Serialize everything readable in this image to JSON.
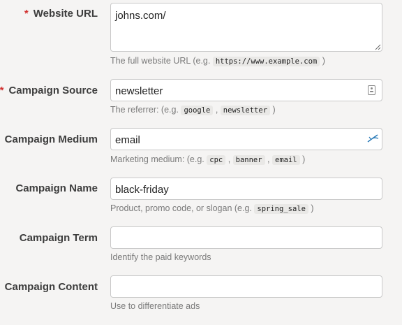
{
  "form": {
    "website_url": {
      "label": "Website URL",
      "required_mark": "*",
      "value": "johns.com/",
      "help_prefix": "The full website URL (e.g. ",
      "help_code": "https://www.example.com",
      "help_suffix": " )"
    },
    "campaign_source": {
      "label": "Campaign Source",
      "required_mark": "*",
      "value": "newsletter",
      "help_prefix": "The referrer: (e.g. ",
      "help_codes": [
        "google",
        "newsletter"
      ],
      "help_sep": " , ",
      "help_suffix": " )",
      "icon": "contact-card-icon"
    },
    "campaign_medium": {
      "label": "Campaign Medium",
      "value": "email",
      "help_prefix": "Marketing medium: (e.g. ",
      "help_codes": [
        "cpc",
        "banner",
        "email"
      ],
      "help_sep": " , ",
      "help_suffix": " )",
      "icon": "feather-arrow-icon",
      "accent": "#2a7bb8"
    },
    "campaign_name": {
      "label": "Campaign Name",
      "value": "black-friday",
      "help_prefix": "Product, promo code, or slogan (e.g. ",
      "help_code": "spring_sale",
      "help_suffix": " )"
    },
    "campaign_term": {
      "label": "Campaign Term",
      "value": "",
      "help": "Identify the paid keywords"
    },
    "campaign_content": {
      "label": "Campaign Content",
      "value": "",
      "help": "Use to differentiate ads"
    }
  },
  "colors": {
    "required": "#d1302f",
    "background": "#f5f4f3"
  }
}
